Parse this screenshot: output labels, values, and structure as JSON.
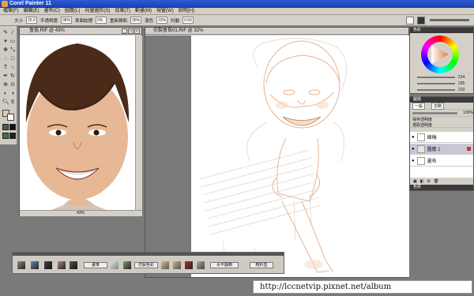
{
  "app": {
    "title": "Corel Painter 11"
  },
  "menu": [
    "檔案(F)",
    "編輯(E)",
    "畫布(C)",
    "圖層(L)",
    "向量圖形(S)",
    "效果(T)",
    "動畫(M)",
    "視窗(W)",
    "說明(H)"
  ],
  "propbar": {
    "size_label": "大小",
    "size_value": "25.0",
    "opacity_label": "不透明度",
    "opacity_value": "38%",
    "grain_label": "表面紋理",
    "grain_value": "0%",
    "resat_label": "重新飽和",
    "resat_value": "35%",
    "bleed_label": "混色",
    "bleed_value": "33%",
    "jitter_label": "抖動",
    "jitter_value": "0.00"
  },
  "doc1": {
    "title": "會長.RIF @ 43%",
    "zoom": "43%"
  },
  "doc2": {
    "title": "仿製會長01.RIF @ 32%"
  },
  "color_panel": {
    "title": "色彩",
    "values": [
      "214",
      "235",
      "210"
    ]
  },
  "layers_panel": {
    "title": "圖層",
    "mode": "一般",
    "blend": "忽略",
    "opacity": "100%",
    "option1": "保存透明度",
    "option2": "選取透明度",
    "items": [
      {
        "name": "線稿",
        "selected": false
      },
      {
        "name": "圖層 1",
        "selected": true
      },
      {
        "name": "畫布",
        "selected": false
      }
    ],
    "footer": "色票"
  },
  "brushbar": {
    "buttons": [
      "畫筆",
      "仿製色彩",
      "水平翻轉",
      "顏料盒"
    ]
  },
  "footer": {
    "url": "http://lccnetvip.pixnet.net/album"
  },
  "colors": {
    "title_blue": "#1b3fa8",
    "canvas_bg": "#ffffff",
    "workspace": "#7a7a7a"
  }
}
